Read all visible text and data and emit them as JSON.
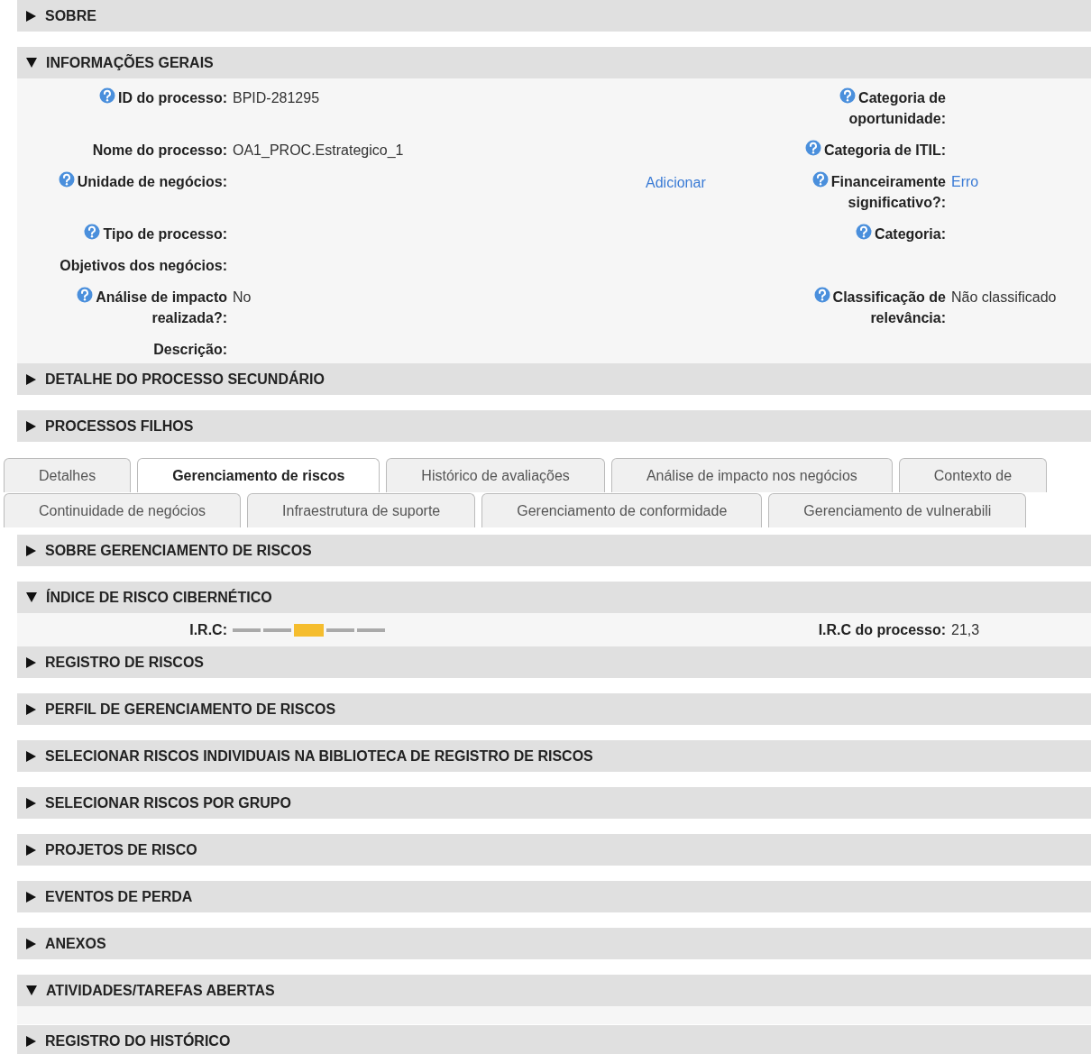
{
  "sections": [
    {
      "title": "SOBRE",
      "expanded": false
    },
    {
      "title": "INFORMAÇÕES GERAIS",
      "expanded": true,
      "kind": "fields",
      "rows": [
        {
          "left": {
            "label": "ID do processo:",
            "help": true,
            "value": "BPID-281295",
            "kind": "text"
          },
          "middle": null,
          "right": {
            "label": "Categoria de oportunidade:",
            "help": true
          }
        },
        {
          "left": {
            "label": "Nome do processo:",
            "help": false,
            "value": "OA1_PROC.Estrategico_1",
            "kind": "text"
          },
          "middle": null,
          "right": {
            "label": "Categoria de ITIL:",
            "help": true
          }
        },
        {
          "left": {
            "label": "Unidade de negócios:",
            "help": true
          },
          "middle": {
            "link": "Adicionar"
          },
          "right": {
            "label": "Financeiramente significativo?:",
            "help": true,
            "value": "Erro",
            "kind": "link"
          }
        },
        {
          "left": {
            "label": "Tipo de processo:",
            "help": true
          },
          "middle": null,
          "right": {
            "label": "Categoria:",
            "help": true
          }
        },
        {
          "left": {
            "label": "Objetivos dos negócios:",
            "help": false
          },
          "middle": null,
          "right": null
        },
        {
          "left": {
            "label": "Análise de impacto realizada?:",
            "help": true,
            "value": "No",
            "kind": "text"
          },
          "middle": null,
          "right": {
            "label": "Classificação de relevância:",
            "help": true,
            "value": "Não classificado",
            "kind": "text"
          }
        },
        {
          "left": {
            "label": "Descrição:",
            "help": false
          },
          "middle": null,
          "right": null
        }
      ]
    },
    {
      "title": "DETALHE DO PROCESSO SECUNDÁRIO",
      "expanded": false
    },
    {
      "title": "PROCESSOS FILHOS",
      "expanded": false
    }
  ],
  "tab_rows": [
    [
      {
        "label": "Detalhes",
        "selected": false
      },
      {
        "label": "Gerenciamento de riscos",
        "selected": true
      },
      {
        "label": "Histórico de avaliações",
        "selected": false
      },
      {
        "label": "Análise de impacto nos negócios",
        "selected": false
      },
      {
        "label": "Contexto de",
        "selected": false
      }
    ],
    [
      {
        "label": "Continuidade de negócios",
        "selected": false
      },
      {
        "label": "Infraestrutura de suporte",
        "selected": false
      },
      {
        "label": "Gerenciamento de conformidade",
        "selected": false
      },
      {
        "label": "Gerenciamento de vulnerabili",
        "selected": false
      }
    ]
  ],
  "tab_sections": [
    {
      "title": "SOBRE GERENCIAMENTO DE RISCOS",
      "expanded": false
    },
    {
      "title": "ÍNDICE DE RISCO CIBERNÉTICO",
      "expanded": true,
      "kind": "irc",
      "irc_label": "I.R.C:",
      "segments": [
        {
          "selected": false
        },
        {
          "selected": false
        },
        {
          "selected": true
        },
        {
          "selected": false
        },
        {
          "selected": false
        }
      ],
      "process_label": "I.R.C do processo:",
      "process_value": "21,3"
    },
    {
      "title": "REGISTRO DE RISCOS",
      "expanded": false
    },
    {
      "title": "PERFIL DE GERENCIAMENTO DE RISCOS",
      "expanded": false
    },
    {
      "title": "SELECIONAR RISCOS INDIVIDUAIS NA BIBLIOTECA DE REGISTRO DE RISCOS",
      "expanded": false
    },
    {
      "title": "SELECIONAR RISCOS POR GRUPO",
      "expanded": false
    },
    {
      "title": "PROJETOS DE RISCO",
      "expanded": false
    },
    {
      "title": "EVENTOS DE PERDA",
      "expanded": false
    },
    {
      "title": "ANEXOS",
      "expanded": false
    },
    {
      "title": "ATIVIDADES/TAREFAS ABERTAS",
      "expanded": true,
      "kind": "empty"
    },
    {
      "title": "REGISTRO DO HISTÓRICO",
      "expanded": false
    }
  ]
}
